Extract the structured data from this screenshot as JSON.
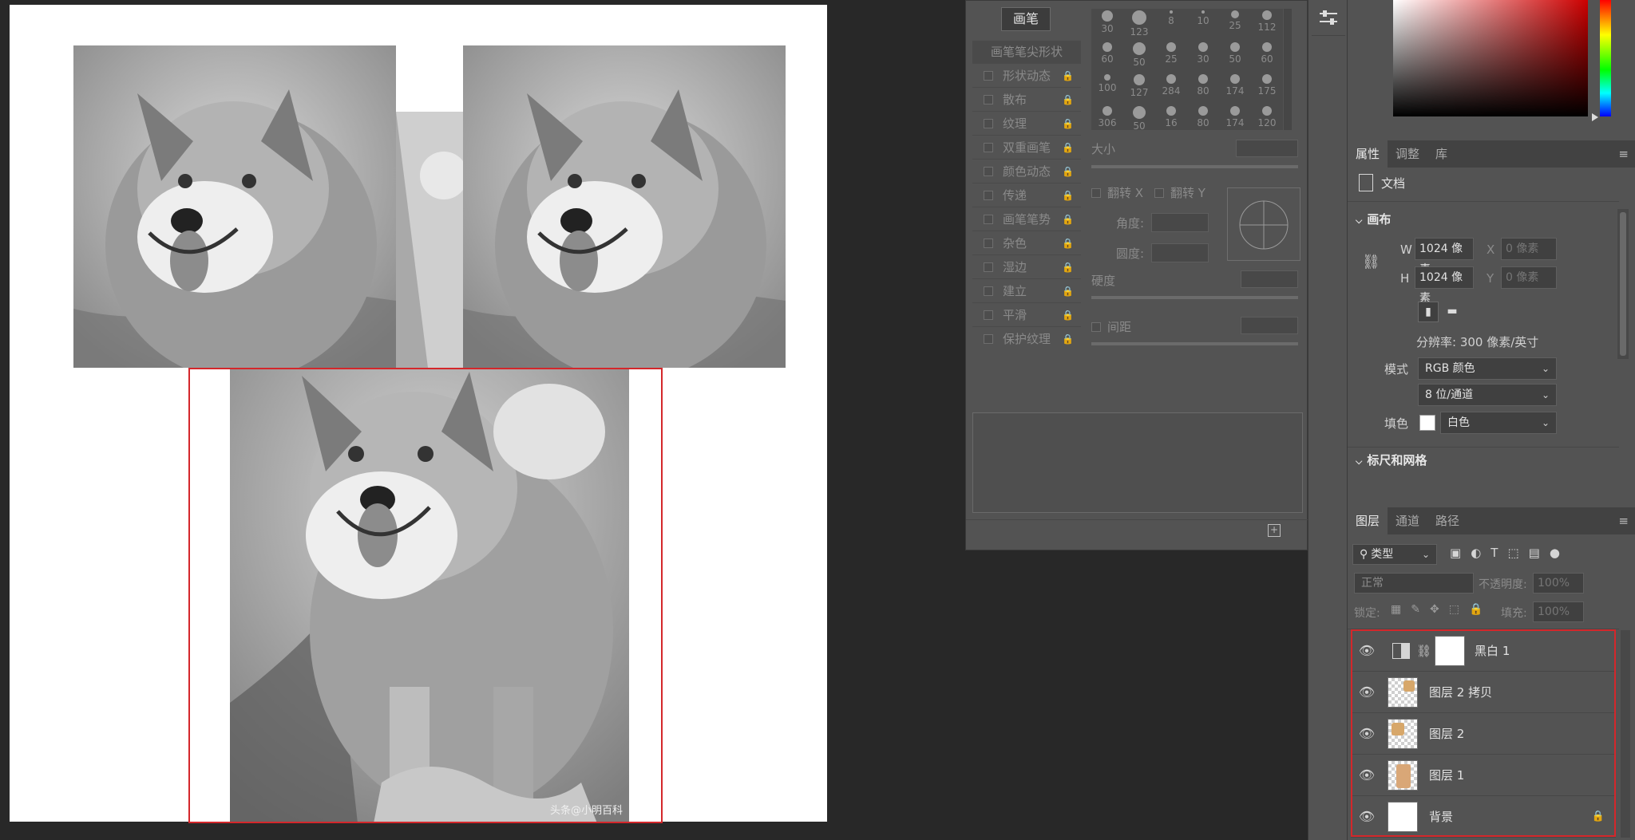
{
  "colors": {
    "selection_red": "#d4272b",
    "panel_bg": "#535353",
    "tab_bg": "#424242"
  },
  "canvas": {
    "photos": [
      {
        "name": "shiba-top-left"
      },
      {
        "name": "shiba-top-right"
      },
      {
        "name": "shiba-bottom-full"
      }
    ],
    "watermark": "头条@小明百科"
  },
  "brush_panel": {
    "brush_button": "画笔",
    "tip_shape_label": "画笔笔尖形状",
    "options": [
      "形状动态",
      "散布",
      "纹理",
      "双重画笔",
      "颜色动态",
      "传递",
      "画笔笔势",
      "杂色",
      "湿边",
      "建立",
      "平滑",
      "保护纹理"
    ],
    "tip_sizes": [
      "30",
      "123",
      "8",
      "10",
      "25",
      "112",
      "60",
      "50",
      "25",
      "30",
      "50",
      "60",
      "100",
      "127",
      "284",
      "80",
      "174",
      "175",
      "306",
      "50",
      "16",
      "80",
      "174",
      "120"
    ],
    "size_label": "大小",
    "flip_x": "翻转 X",
    "flip_y": "翻转 Y",
    "angle_label": "角度:",
    "roundness_label": "圆度:",
    "hardness_label": "硬度",
    "spacing_label": "间距"
  },
  "properties": {
    "tabs": [
      "属性",
      "调整",
      "库"
    ],
    "doc_label": "文档",
    "canvas_header": "画布",
    "w_label": "W",
    "w_value": "1024 像素",
    "x_label": "X",
    "x_placeholder": "0 像素",
    "h_label": "H",
    "h_value": "1024 像素",
    "y_label": "Y",
    "y_placeholder": "0 像素",
    "resolution": "分辨率: 300 像素/英寸",
    "mode_label": "模式",
    "mode_value": "RGB 颜色",
    "depth_value": "8 位/通道",
    "fill_label": "填色",
    "fill_value": "白色",
    "rulers_header": "标尺和网格"
  },
  "layers": {
    "tabs": [
      "图层",
      "通道",
      "路径"
    ],
    "filter_kind": "类型",
    "blend_mode": "正常",
    "opacity_label": "不透明度:",
    "opacity_value": "100%",
    "lock_label": "锁定:",
    "fill_label": "填充:",
    "fill_value": "100%",
    "items": [
      {
        "name": "黑白 1",
        "type": "adjustment"
      },
      {
        "name": "图层 2 拷贝",
        "type": "pixel"
      },
      {
        "name": "图层 2",
        "type": "pixel"
      },
      {
        "name": "图层 1",
        "type": "pixel"
      },
      {
        "name": "背景",
        "type": "background",
        "locked": true
      }
    ]
  }
}
